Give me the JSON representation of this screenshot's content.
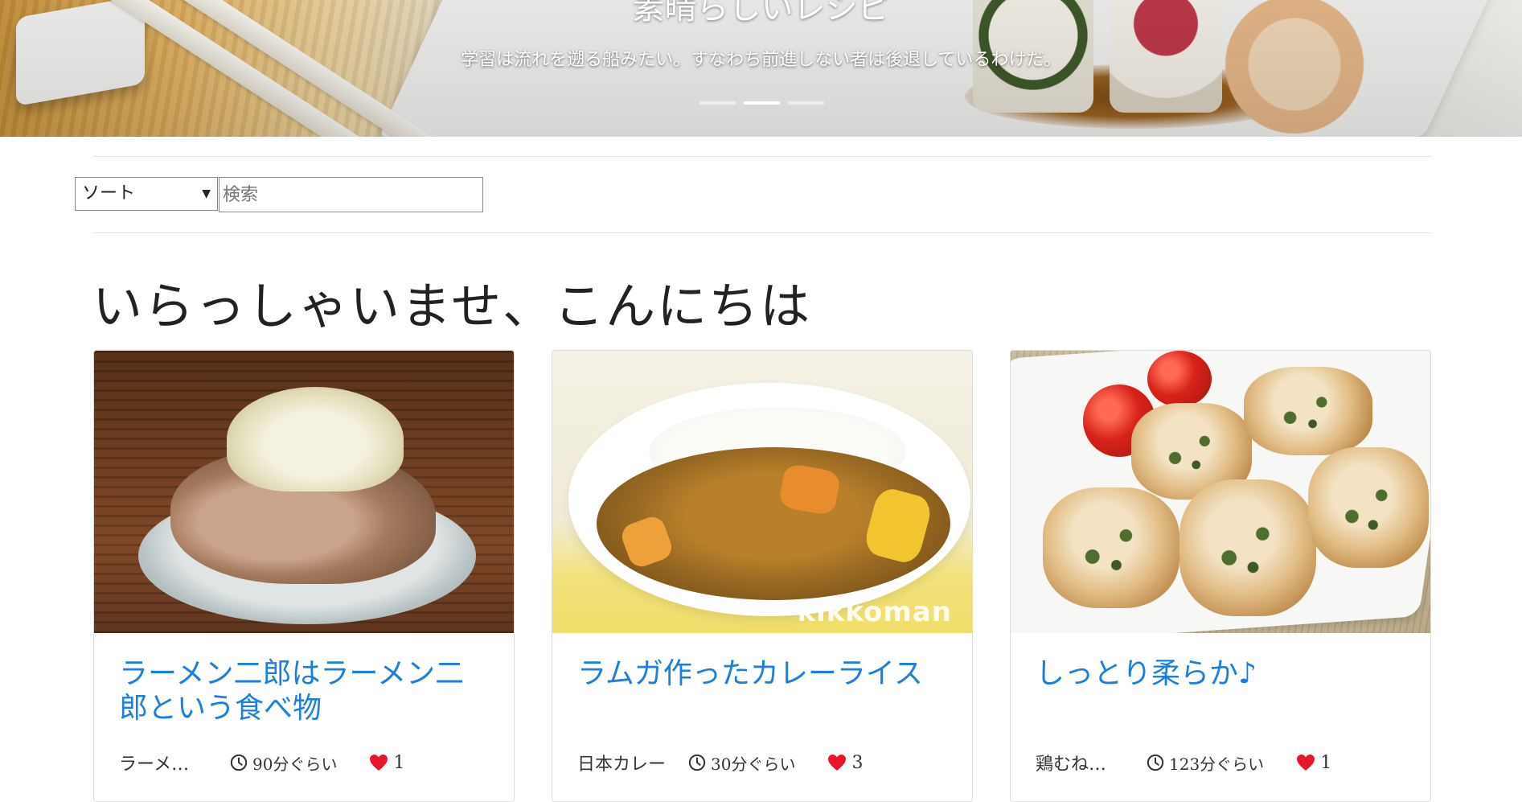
{
  "hero": {
    "title": "素晴らしいレシピ",
    "caption": "学習は流れを遡る船みたい。すなわち前進しない者は後退しているわけだ。",
    "indicators": [
      {
        "label": "slide 1",
        "active": false
      },
      {
        "label": "slide 2",
        "active": true
      },
      {
        "label": "slide 3",
        "active": false
      }
    ]
  },
  "filters": {
    "sort": {
      "selected": "ソート",
      "icon": "caret-down-icon"
    },
    "search": {
      "placeholder": "検索",
      "value": ""
    }
  },
  "welcome": "いらっしゃいませ、こんにちは",
  "colors": {
    "link": "#1a7fe0",
    "heart": "#e8152c"
  },
  "recipes": [
    {
      "title": "ラーメン二郎はラーメン二郎という食べ物",
      "category": "ラーメ…",
      "time": "90分ぐらい",
      "likes": "1",
      "image": "ramen-photo"
    },
    {
      "title": "ラムガ作ったカレーライス",
      "category": "日本カレー",
      "time": "30分ぐらい",
      "likes": "3",
      "image": "curry-photo",
      "watermark": "kikkoman"
    },
    {
      "title": "しっとり柔らか♪",
      "category": "鶏むね…",
      "time": "123分ぐらい",
      "likes": "1",
      "image": "chicken-photo"
    }
  ]
}
